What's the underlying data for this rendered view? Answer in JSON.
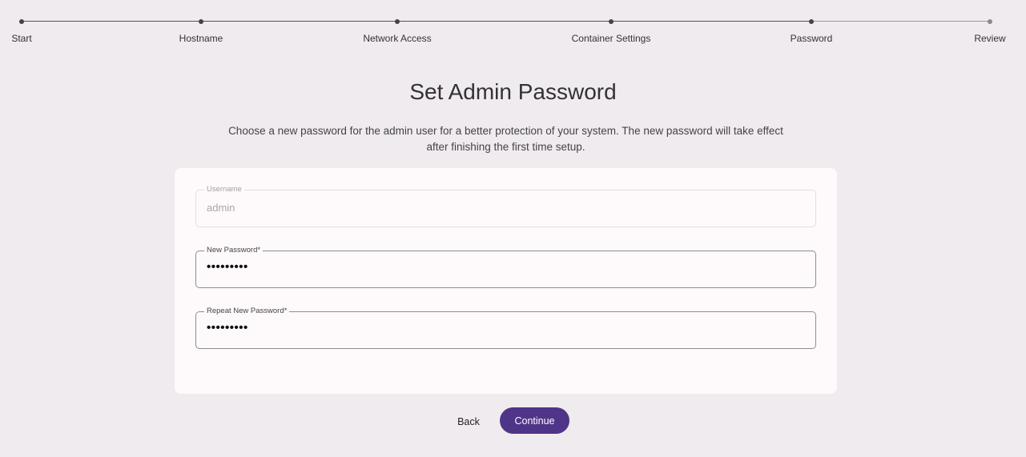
{
  "stepper": {
    "steps": [
      {
        "label": "Start"
      },
      {
        "label": "Hostname"
      },
      {
        "label": "Network Access"
      },
      {
        "label": "Container Settings"
      },
      {
        "label": "Password"
      },
      {
        "label": "Review"
      }
    ]
  },
  "header": {
    "title": "Set Admin Password",
    "description": "Choose a new password for the admin user for a better protection of your system. The new password will take effect after finishing the first time setup."
  },
  "form": {
    "username": {
      "label": "Username",
      "value": "admin"
    },
    "new_password": {
      "label": "New Password*",
      "value": "•••••••••"
    },
    "repeat_password": {
      "label": "Repeat New Password*",
      "value": "•••••••••"
    }
  },
  "actions": {
    "back_label": "Back",
    "continue_label": "Continue"
  },
  "colors": {
    "primary": "#4f3588",
    "background": "#f0ebee",
    "card": "#fefafc"
  }
}
